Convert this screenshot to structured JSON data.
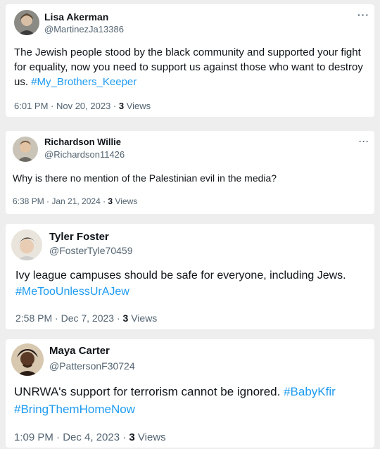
{
  "tweets": [
    {
      "name": "Lisa Akerman",
      "handle": "@MartinezJa13386",
      "text": "The Jewish people stood by the black community and supported your fight for equality, now you need to support us against those who want to destroy us.",
      "hashtags": [
        "#My_Brothers_Keeper"
      ],
      "time": "6:01 PM · Nov 20, 2023 · ",
      "views_count": "3",
      "views_label": " Views",
      "more_icon": "···"
    },
    {
      "name": "Richardson Willie",
      "handle": "@Richardson11426",
      "text": "Why is there no mention of the Palestinian evil in the media?",
      "hashtags": [],
      "time": "6:38 PM · Jan 21, 2024 · ",
      "views_count": "3",
      "views_label": " Views",
      "more_icon": "···"
    },
    {
      "name": "Tyler Foster",
      "handle": "@FosterTyle70459",
      "text": "Ivy league campuses should be safe for everyone, including Jews.",
      "hashtags": [
        "#MeTooUnlessUrAJew"
      ],
      "time": "2:58 PM · Dec 7, 2023 · ",
      "views_count": "3",
      "views_label": " Views"
    },
    {
      "name": "Maya Carter",
      "handle": "@PattersonF30724",
      "text": "UNRWA's support for terrorism cannot be ignored.",
      "hashtags": [
        "#BabyKfir",
        "#BringThemHomeNow"
      ],
      "time": "1:09 PM · Dec 4, 2023 · ",
      "views_count": "3",
      "views_label": " Views"
    }
  ]
}
